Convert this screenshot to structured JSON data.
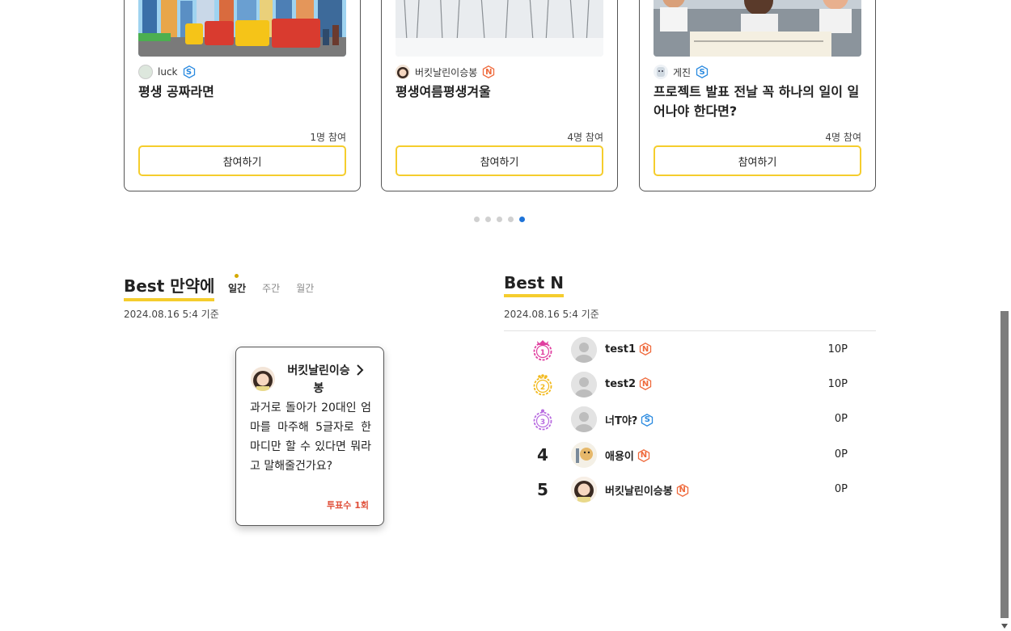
{
  "cards": [
    {
      "author": "luck",
      "badge": "S",
      "title": "평생 공짜라면",
      "count": "1명 참여",
      "button": "참여하기"
    },
    {
      "author": "버킷날린이승봉",
      "badge": "N",
      "title": "평생여름평생겨울",
      "count": "4명 참여",
      "button": "참여하기"
    },
    {
      "author": "게진",
      "badge": "S",
      "title": "프로젝트 발표 전날 꼭 하나의 일이 일어나야 한다면?",
      "count": "4명 참여",
      "button": "참여하기"
    }
  ],
  "carousel": {
    "total": 5,
    "active": 4
  },
  "best_manyake": {
    "title": "Best 만약에",
    "tabs": [
      "일간",
      "주간",
      "월간"
    ],
    "active_tab": "일간",
    "base_date": "2024.08.16 5:4 기준",
    "card": {
      "author": "버킷날린이승봉",
      "question": "과거로 돌아가 20대인 엄마를 마주해 5글자로 한 마디만 할 수 있다면 뭐라고 말해줄건가요?",
      "votes": "투표수 1회"
    }
  },
  "best_n": {
    "title": "Best N",
    "base_date": "2024.08.16 5:4 기준",
    "rows": [
      {
        "rank": "1",
        "name": "test1",
        "badge": "N",
        "points": "10P",
        "medal_color": "#e040a0"
      },
      {
        "rank": "2",
        "name": "test2",
        "badge": "N",
        "points": "10P",
        "medal_color": "#f2b91c"
      },
      {
        "rank": "3",
        "name": "너T야?",
        "badge": "S",
        "points": "0P",
        "medal_color": "#b86be0"
      },
      {
        "rank": "4",
        "name": "애용이",
        "badge": "N",
        "points": "0P"
      },
      {
        "rank": "5",
        "name": "버킷날린이승봉",
        "badge": "N",
        "points": "0P"
      }
    ]
  },
  "colors": {
    "accent": "#f5cd2d",
    "dot_active": "#1e73d8",
    "badge_s": "#2a8ae0",
    "badge_n": "#ef6a3c",
    "votes": "#e0503a"
  }
}
